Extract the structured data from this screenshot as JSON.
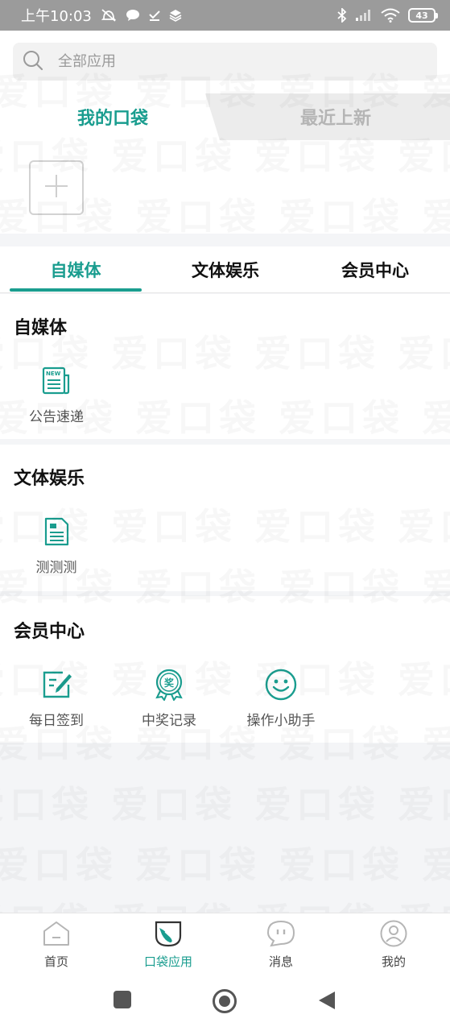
{
  "status_bar": {
    "time": "上午10:03",
    "battery": "43"
  },
  "search": {
    "placeholder": "全部应用"
  },
  "pocket_tabs": {
    "active": "我的口袋",
    "inactive": "最近上新"
  },
  "watermark_text": "爱口袋 爱口袋 爱口袋 爱口袋",
  "category_tabs": [
    "自媒体",
    "文体娱乐",
    "会员中心"
  ],
  "sections": [
    {
      "title": "自媒体",
      "items": [
        {
          "label": "公告速递",
          "icon": "newspaper-icon"
        }
      ]
    },
    {
      "title": "文体娱乐",
      "items": [
        {
          "label": "测测测",
          "icon": "document-icon"
        }
      ]
    },
    {
      "title": "会员中心",
      "items": [
        {
          "label": "每日签到",
          "icon": "checkin-icon"
        },
        {
          "label": "中奖记录",
          "icon": "award-icon"
        },
        {
          "label": "操作小助手",
          "icon": "smiley-icon"
        }
      ]
    }
  ],
  "award_badge_char": "奖",
  "new_badge": "NEW",
  "bottom_nav": [
    {
      "label": "首页",
      "icon": "home-icon"
    },
    {
      "label": "口袋应用",
      "icon": "pocket-icon"
    },
    {
      "label": "消息",
      "icon": "message-icon"
    },
    {
      "label": "我的",
      "icon": "profile-icon"
    }
  ],
  "colors": {
    "accent": "#1a9d8f",
    "status_bar": "#9b9b9b"
  }
}
